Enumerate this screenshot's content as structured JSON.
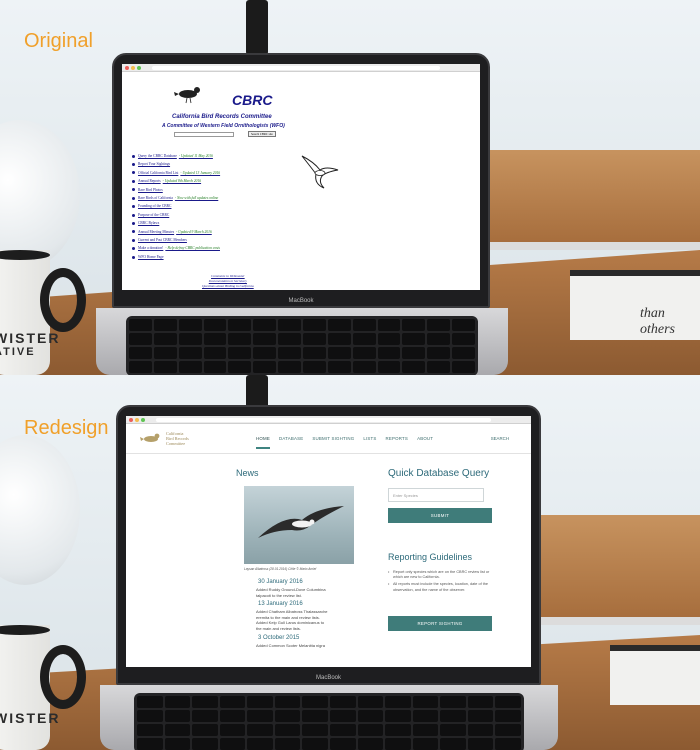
{
  "labels": {
    "original": "Original",
    "redesign": "Redesign"
  },
  "accent_color": "#f0a02a",
  "laptop_brand": "MacBook",
  "mug_text": [
    "WISTER",
    "ATIVE"
  ],
  "books_text": "than others",
  "original_site": {
    "title": "CBRC",
    "full_name": "California Bird Records Committee",
    "subtitle": "A Committee of Western Field Ornithologists (WFO)",
    "search_button": "Search CBRC site",
    "links": [
      {
        "label": "Query the CBRC Database",
        "note": "- Updated 11 May 2016"
      },
      {
        "label": "Report Your Sightings",
        "note": ""
      },
      {
        "label": "Official California Bird List",
        "note": "- Updated 13 January 2016"
      },
      {
        "label": "Annual Reports",
        "note": "- Updated 8th March 2016"
      },
      {
        "label": "Rare Bird Photos",
        "note": ""
      },
      {
        "label": "Rare Birds of California",
        "note": "- Now with full updates online"
      },
      {
        "label": "Founding of the CBRC",
        "note": ""
      },
      {
        "label": "Purpose of the CBRC",
        "note": ""
      },
      {
        "label": "CBRC Bylaws",
        "note": ""
      },
      {
        "label": "Annual Meeting Minutes",
        "note": "- Updated 9 March 2016"
      },
      {
        "label": "Current and Past CBRC Members",
        "note": ""
      },
      {
        "label": "Make a donation!",
        "note": "- Help defray CBRC publication costs"
      },
      {
        "label": "WFO Home Page",
        "note": ""
      }
    ],
    "footer_links": [
      "Comments to Webmaster",
      "Documentation to Secretary",
      "Questions about Birding in California"
    ]
  },
  "redesign_site": {
    "logo_text": [
      "California",
      "Bird Records",
      "Committee"
    ],
    "nav": [
      "HOME",
      "DATABASE",
      "SUBMIT SIGHTING",
      "LISTS",
      "REPORTS",
      "ABOUT"
    ],
    "search_link": "SEARCH",
    "news_heading": "News",
    "image_caption": "Laysan Albatross (28.01.2016) Chile © Mario Amiel",
    "news": [
      {
        "date": "30 January 2016",
        "items": [
          "Added Ruddy Ground-Dove Columbina",
          "talpacoti to the review list."
        ]
      },
      {
        "date": "13 January 2016",
        "items": [
          "Added Chatham Albatross Thalassarche",
          "eremita to the main and review lists.",
          "Added Kelp Gull Larus dominicanus to",
          "the main and review lists."
        ]
      },
      {
        "date": "3 October 2015",
        "items": [
          "Added Common Scoter Melanitta nigra"
        ]
      }
    ],
    "query_heading": "Quick Database Query",
    "query_placeholder": "Enter Species",
    "submit_button": "SUBMIT",
    "guidelines_heading": "Reporting Guidelines",
    "guidelines": [
      "Report only species which are on the CBRC review list or which are new to California.",
      "All reports must include the species, location, date of the observation, and the name of the observer."
    ],
    "report_button": "REPORT SIGHTING"
  }
}
